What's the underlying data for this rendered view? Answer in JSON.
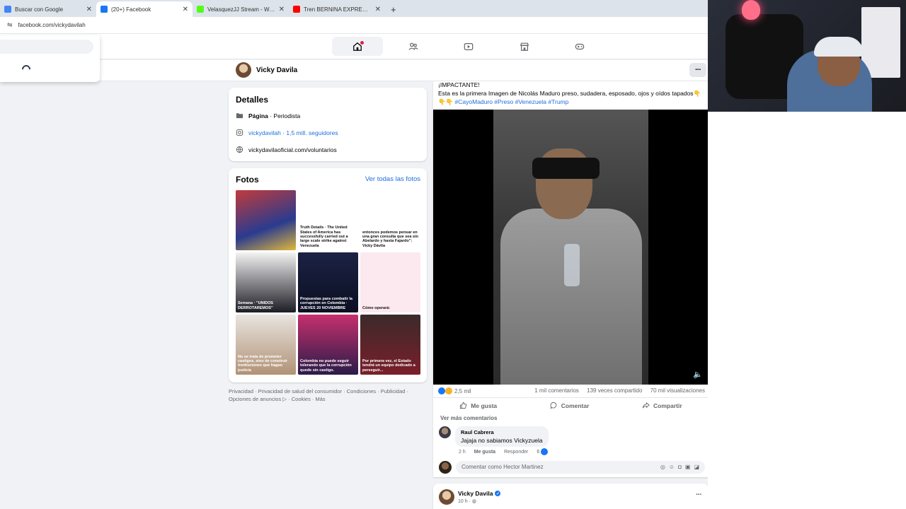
{
  "browser": {
    "tabs": [
      {
        "title": "Buscar con Google",
        "color": "#4285f4",
        "active": false
      },
      {
        "title": "(20+) Facebook",
        "color": "#1877f2",
        "active": true
      },
      {
        "title": "VelasquezJJ Stream - Watch Live",
        "color": "#53fc18",
        "active": false
      },
      {
        "title": "Tren BERNINA EXPRESS de",
        "color": "#ff0000",
        "active": false
      }
    ],
    "close_glyph": "✕",
    "new_tab_glyph": "+",
    "url": "facebook.com/vickydavilah"
  },
  "profile": {
    "name": "Vicky Davila"
  },
  "details": {
    "title": "Detalles",
    "category_label": "Página",
    "category_value": " · Periodista",
    "instagram_handle": "vickydavilah",
    "instagram_followers": " · 1,5 mill. seguidores",
    "website": "vickydavilaoficial.com/voluntarios"
  },
  "photos": {
    "title": "Fotos",
    "see_all": "Ver todas las fotos",
    "items": [
      {
        "bg": "linear-gradient(160deg,#c23b3b,#2a3b8f 60%,#e1b83c)",
        "caption": ""
      },
      {
        "bg": "#ffffff",
        "caption": "Truth Details · The United States of America has successfully carried out a large scale strike against Venezuela"
      },
      {
        "bg": "#ffffff",
        "caption": "entonces podemos pensar en una gran consulta que sea sin Abelardo y hasta Fajardo\": Vicky Dávila"
      },
      {
        "bg": "linear-gradient(180deg,#f3f3f3,#1c1c24)",
        "caption": "Semana · \"UNIDOS DERROTAREMOS\""
      },
      {
        "bg": "linear-gradient(180deg,#1b2244,#0c0f22)",
        "caption": "Propuestas para combatir la corrupción en Colombia · JUEVES 20 NOVIEMBRE"
      },
      {
        "bg": "#fbe9ef",
        "caption": "Cómo operará:"
      },
      {
        "bg": "linear-gradient(180deg,#e8e4df,#b19276)",
        "caption": "No se trata de prometer castigos, sino de construir instituciones que hagan justicia"
      },
      {
        "bg": "linear-gradient(180deg,#c6306d,#2a1b48)",
        "caption": "Colombia no puede seguir tolerando que la corrupción quede sin castigo."
      },
      {
        "bg": "linear-gradient(180deg,#3b2a2a,#7a1f2a)",
        "caption": "Por primera vez, el Estado tendrá un equipo dedicado a perseguir..."
      }
    ]
  },
  "footer": {
    "line1": "Privacidad · Privacidad de salud del consumidor · Condiciones · Publicidad ·",
    "line2": "Opciones de anuncios ▷ · Cookies · Más"
  },
  "post": {
    "line1": "¡IMPACTANTE!",
    "line2": "Esta es la primera Imagen de Nicolás Maduro preso, sudadera, esposado, ojos y oídos tapados👇",
    "emoji_prefix": "👇👇",
    "hashtags": "#CayoMaduro #Preso #Venezuela #Trump",
    "reactions_count": "2,5 mil",
    "comments": "1 mil comentarios",
    "shares": "139 veces compartido",
    "views": "70 mil visualizaciones",
    "like_label": "Me gusta",
    "comment_label": "Comentar",
    "share_label": "Compartir",
    "more_comments": "Ver más comentarios",
    "top_comment": {
      "author": "Raul Cabrera",
      "text": "Jajaja no sabiamos Vickyzuela",
      "time": "2 h",
      "like": "Me gusta",
      "reply": "Responder",
      "likes": "6"
    },
    "compose_placeholder": "Comentar como Hector Martinez"
  },
  "post2": {
    "author": "Vicky Davila",
    "time": "10 h · "
  },
  "colors": {
    "fb_blue": "#1877f2",
    "link": "#216fdb"
  }
}
